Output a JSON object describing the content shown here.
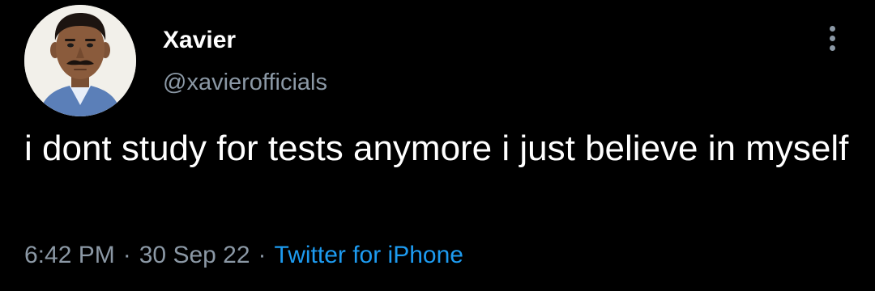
{
  "author": {
    "display_name": "Xavier",
    "handle": "@xavierofficials",
    "avatar_icon": "profile-photo"
  },
  "more_icon": "more-vertical-icon",
  "tweet": {
    "text": "i dont study for tests anymore i just believe in myself",
    "time": "6:42 PM",
    "date": "30 Sep 22",
    "separator": "·",
    "source": "Twitter for iPhone"
  },
  "colors": {
    "background": "#000000",
    "text": "#ffffff",
    "secondary": "#8b98a5",
    "link": "#1d9bf0"
  }
}
